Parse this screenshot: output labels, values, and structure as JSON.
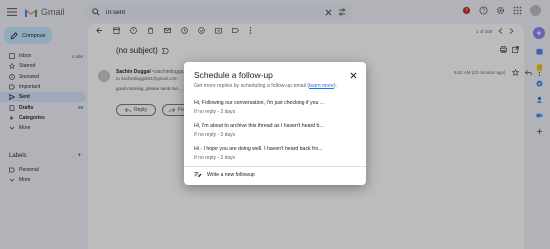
{
  "header": {
    "app_name": "Gmail",
    "search_value": "in:sent",
    "colors": {
      "gmail_red": "#ea4335",
      "accent": "#8a7ff0"
    }
  },
  "sidebar": {
    "compose_label": "Compose",
    "items": [
      {
        "label": "Inbox",
        "count": "4,466",
        "icon": "inbox-icon"
      },
      {
        "label": "Starred",
        "count": "",
        "icon": "star-icon"
      },
      {
        "label": "Snoozed",
        "count": "",
        "icon": "clock-icon"
      },
      {
        "label": "Important",
        "count": "",
        "icon": "label-icon"
      },
      {
        "label": "Sent",
        "count": "",
        "icon": "send-icon"
      },
      {
        "label": "Drafts",
        "count": "29",
        "icon": "draft-icon"
      },
      {
        "label": "Categories",
        "count": "",
        "icon": "tag-icon"
      },
      {
        "label": "More",
        "count": "",
        "icon": "chevron-down-icon"
      }
    ],
    "labels_heading": "Labels",
    "labels_add": "+",
    "labels": [
      {
        "label": "Personal",
        "icon": "label-icon"
      },
      {
        "label": "More",
        "icon": "chevron-down-icon"
      }
    ]
  },
  "main": {
    "pager": "1 of 105",
    "subject": "(no subject)",
    "sender_name": "Sachin Duggal",
    "sender_email": "<sachindugga...",
    "recipients": "to sachinduggal04@gmail.com",
    "snippet": "good morning, please send me...",
    "time": "9:52 AM (22 minutes ago)",
    "reply_label": "Reply",
    "forward_label": "Forward"
  },
  "dialog": {
    "title": "Schedule a follow-up",
    "subtitle": "Get more replies by scheduling a follow-up email",
    "learn_more": "learn more",
    "options": [
      {
        "text": "Hi, Following our conversation, I'm just checking if you ...",
        "meta": "If no reply - 3 days"
      },
      {
        "text": "Hi, I'm about to archive this thread as I haven't heard b...",
        "meta": "If no reply - 3 days"
      },
      {
        "text": "Hi - I hope you are doing well. I haven't heard back fro...",
        "meta": "If no reply - 3 days"
      }
    ],
    "new_followup": "Write a new followup"
  }
}
